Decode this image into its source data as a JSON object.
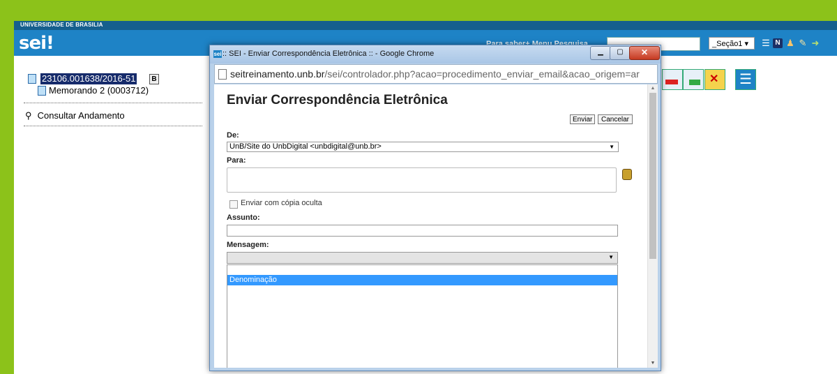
{
  "sei": {
    "university": "UNIVERSIDADE DE BRASILIA",
    "logo": "sei!",
    "header_links": "Para saber+  Menu  Pesquisa",
    "unit_select": "_Seção1",
    "process_number": "23106.001638/2016-51",
    "process_badge": "B",
    "document": "Memorando 2 (0003712)",
    "consult_link": "Consultar Andamento",
    "header_icons": [
      "menu-icon",
      "notes-icon",
      "user-icon",
      "tools-icon",
      "exit-icon"
    ],
    "toolbar_icons": [
      "pdf-icon",
      "zip-icon",
      "email-icon",
      "list-icon"
    ]
  },
  "popup": {
    "window_logo": "sei",
    "window_title": ":: SEI - Enviar Correspondência Eletrônica :: - Google Chrome",
    "url_host": "seitreinamento.unb.br",
    "url_path": "/sei/controlador.php?acao=procedimento_enviar_email&acao_origem=ar",
    "form_title": "Enviar Correspondência Eletrônica",
    "btn_enviar": "Enviar",
    "btn_cancelar": "Cancelar",
    "label_de": "De:",
    "de_value": "UnB/Site do UnbDigital <unbdigital@unb.br>",
    "label_para": "Para:",
    "checkbox_label": "Enviar com cópia oculta",
    "label_assunto": "Assunto:",
    "label_mensagem": "Mensagem:",
    "mensagem_options": [
      "",
      "Denominação"
    ],
    "selected_option": "Denominação"
  },
  "colors": {
    "background": "#8cc21a",
    "header": "#1e83c6",
    "top_strip": "#155f8d",
    "selection": "#3399ff",
    "process_highlight": "#162b6b"
  }
}
